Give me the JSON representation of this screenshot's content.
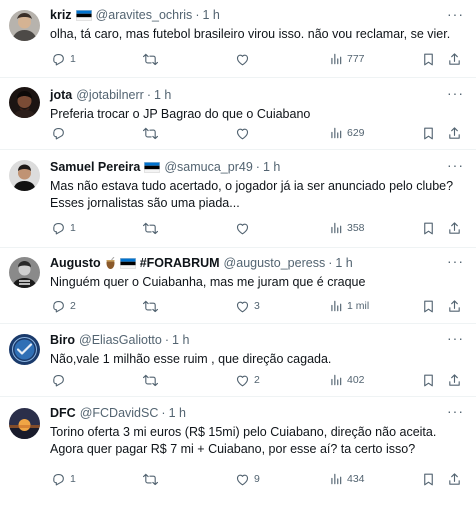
{
  "separator": "·",
  "more_label": "···",
  "colors": {
    "text": "#0f1419",
    "secondary": "#536471",
    "divider": "#eff3f4"
  },
  "icons": [
    "reply-icon",
    "retweet-icon",
    "like-icon",
    "views-icon",
    "bookmark-icon",
    "share-icon",
    "more-icon",
    "estonia-flag-icon",
    "mate-gourd-icon"
  ],
  "posts": [
    {
      "name": "kriz",
      "name_suffix": "",
      "handle": "@aravites_ochris",
      "time": "1 h",
      "lines": [
        "olha, tá caro, mas futebol brasileiro virou isso. não vou reclamar, se vier."
      ],
      "replies": "1",
      "retweets": "",
      "likes": "",
      "views": "777"
    },
    {
      "name": "jota",
      "name_suffix": "",
      "handle": "@jotabilnerr",
      "time": "1 h",
      "lines": [
        "Preferia trocar o JP Bagrao do que o Cuiabano"
      ],
      "replies": "",
      "retweets": "",
      "likes": "",
      "views": "629"
    },
    {
      "name": "Samuel Pereira",
      "name_suffix": "",
      "handle": "@samuca_pr49",
      "time": "1 h",
      "lines": [
        "Mas não estava tudo acertado, o jogador já ia ser anunciado pelo clube?",
        "Esses jornalistas são uma piada..."
      ],
      "replies": "1",
      "retweets": "",
      "likes": "",
      "views": "358"
    },
    {
      "name": "Augusto",
      "name_suffix": "#FORABRUM",
      "handle": "@augusto_peress",
      "time": "1 h",
      "lines": [
        "Ninguém quer o Cuiabanha, mas me juram que é craque"
      ],
      "replies": "2",
      "retweets": "",
      "likes": "3",
      "views": "1 mil"
    },
    {
      "name": "Biro",
      "name_suffix": "",
      "handle": "@EliasGaliotto",
      "time": "1 h",
      "lines": [
        "Não,vale 1 milhão esse ruim , que direção cagada."
      ],
      "replies": "",
      "retweets": "",
      "likes": "2",
      "views": "402"
    },
    {
      "name": "DFC",
      "name_suffix": "",
      "handle": "@FCDavidSC",
      "time": "1 h",
      "lines": [
        "Torino oferta 3 mi euros (R$ 15mi) pelo Cuiabano, direção não aceita.",
        "Agora quer pagar R$ 7 mi + Cuiabano, por esse aí? ta certo isso?"
      ],
      "replies": "1",
      "retweets": "",
      "likes": "9",
      "views": "434"
    }
  ]
}
